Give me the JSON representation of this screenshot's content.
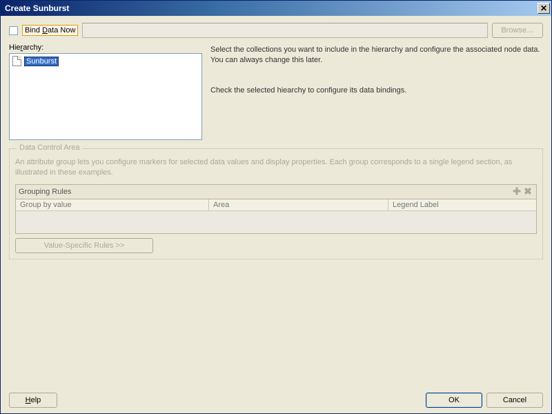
{
  "title": "Create Sunburst",
  "bind_row": {
    "checkbox_checked": false,
    "label_prefix": "Bind ",
    "label_u": "D",
    "label_suffix": "ata Now",
    "path_value": "",
    "browse_label": "Browse…"
  },
  "hierarchy": {
    "label_prefix": "Hie",
    "label_u": "r",
    "label_suffix": "archy:",
    "items": [
      {
        "label": "Sunburst"
      }
    ]
  },
  "info": {
    "p1": "Select the collections you want to include in the hierarchy and configure the associated node data. You can always change this later.",
    "p2": "Check the selected hiearchy to configure its data bindings."
  },
  "data_control": {
    "legend": "Data Control Area",
    "desc": "An attribute group lets you configure markers for selected data values and display properties. Each group corresponds to a single legend section, as illustrated in these examples.",
    "grouping_title": "Grouping Rules",
    "columns": {
      "c1": "Group by value",
      "c2": "Area",
      "c3": "Legend Label"
    },
    "value_rules_label": "Value-Specific Rules >>"
  },
  "footer": {
    "help": "Help",
    "ok": "OK",
    "cancel": "Cancel"
  }
}
